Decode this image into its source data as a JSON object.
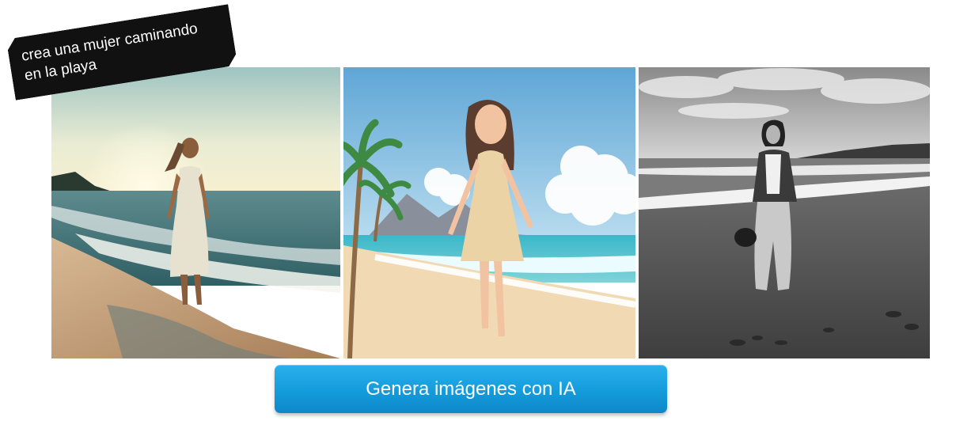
{
  "prompt": {
    "line1": "crea una mujer caminando",
    "line2": "en la playa"
  },
  "cta": {
    "label": "Genera imágenes con IA"
  },
  "images": [
    {
      "style": "photorealistic sunset beach"
    },
    {
      "style": "3d cartoon tropical beach"
    },
    {
      "style": "black and white beach photo"
    }
  ],
  "colors": {
    "button": "#149bdb",
    "tag": "#111111"
  }
}
